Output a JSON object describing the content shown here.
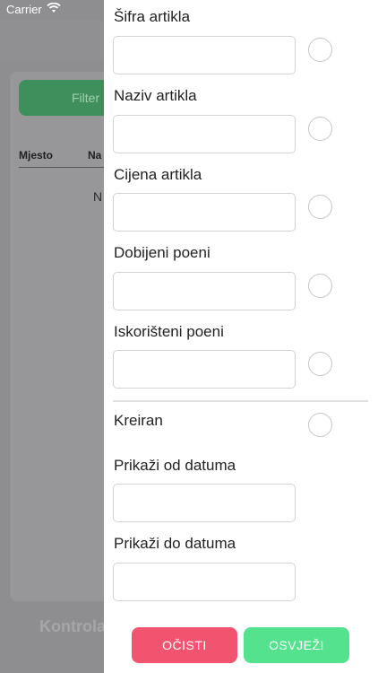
{
  "status_bar": {
    "carrier": "Carrier",
    "wifi_icon": "wifi-icon"
  },
  "background": {
    "filter_button": "Filter",
    "columns": [
      "Mjesto",
      "Na"
    ],
    "empty_text": "N",
    "bottom_title": "Kontrola"
  },
  "filters": {
    "fields": [
      {
        "label": "Šifra artikla",
        "value": ""
      },
      {
        "label": "Naziv artikla",
        "value": ""
      },
      {
        "label": "Cijena artikla",
        "value": ""
      },
      {
        "label": "Dobijeni poeni",
        "value": ""
      },
      {
        "label": "Iskorišteni poeni",
        "value": ""
      }
    ],
    "created_label": "Kreiran",
    "date_from_label": "Prikaži od datuma",
    "date_from_value": "",
    "date_to_label": "Prikaži do datuma",
    "date_to_value": ""
  },
  "actions": {
    "clear_label": "OČISTI",
    "refresh_label": "OSVJEŽI"
  },
  "colors": {
    "clear": "#f0546f",
    "refresh": "#55e28f",
    "overlay": "#8e8e90"
  }
}
